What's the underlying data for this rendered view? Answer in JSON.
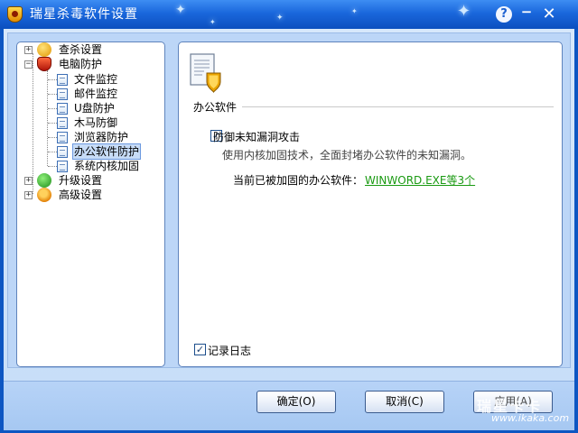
{
  "window": {
    "title": "瑞星杀毒软件设置",
    "help": "?",
    "minimize": "−",
    "close": "✕"
  },
  "tree": {
    "items": [
      {
        "label": "查杀设置",
        "expander": "+",
        "icon": "scan-settings-icon"
      },
      {
        "label": "电脑防护",
        "expander": "−",
        "icon": "computer-protection-icon"
      },
      {
        "label": "文件监控",
        "icon": "document-icon"
      },
      {
        "label": "邮件监控",
        "icon": "document-icon"
      },
      {
        "label": "U盘防护",
        "icon": "document-icon"
      },
      {
        "label": "木马防御",
        "icon": "document-icon"
      },
      {
        "label": "浏览器防护",
        "icon": "document-icon"
      },
      {
        "label": "办公软件防护",
        "icon": "document-icon",
        "selected": true
      },
      {
        "label": "系统内核加固",
        "icon": "document-icon"
      },
      {
        "label": "升级设置",
        "expander": "+",
        "icon": "update-settings-icon"
      },
      {
        "label": "高级设置",
        "expander": "+",
        "icon": "advanced-settings-icon"
      }
    ]
  },
  "panel": {
    "title": "办公软件",
    "defend_checked": true,
    "defend_label": "防御未知漏洞攻击",
    "defend_desc": "使用内核加固技术，全面封堵办公软件的未知漏洞。",
    "current_label": "当前已被加固的办公软件：",
    "current_value": "WINWORD.EXE等3个",
    "log_checked": true,
    "log_label": "记录日志"
  },
  "buttons": {
    "ok": "确定(O)",
    "cancel": "取消(C)",
    "apply": "应用(A)"
  },
  "watermark": {
    "brand": "瑞星卡卡",
    "url": "www.ikaka.com"
  },
  "colors": {
    "titlebar": "#1a67dc",
    "link": "#1a9a12",
    "selection": "#c7dcf7"
  }
}
